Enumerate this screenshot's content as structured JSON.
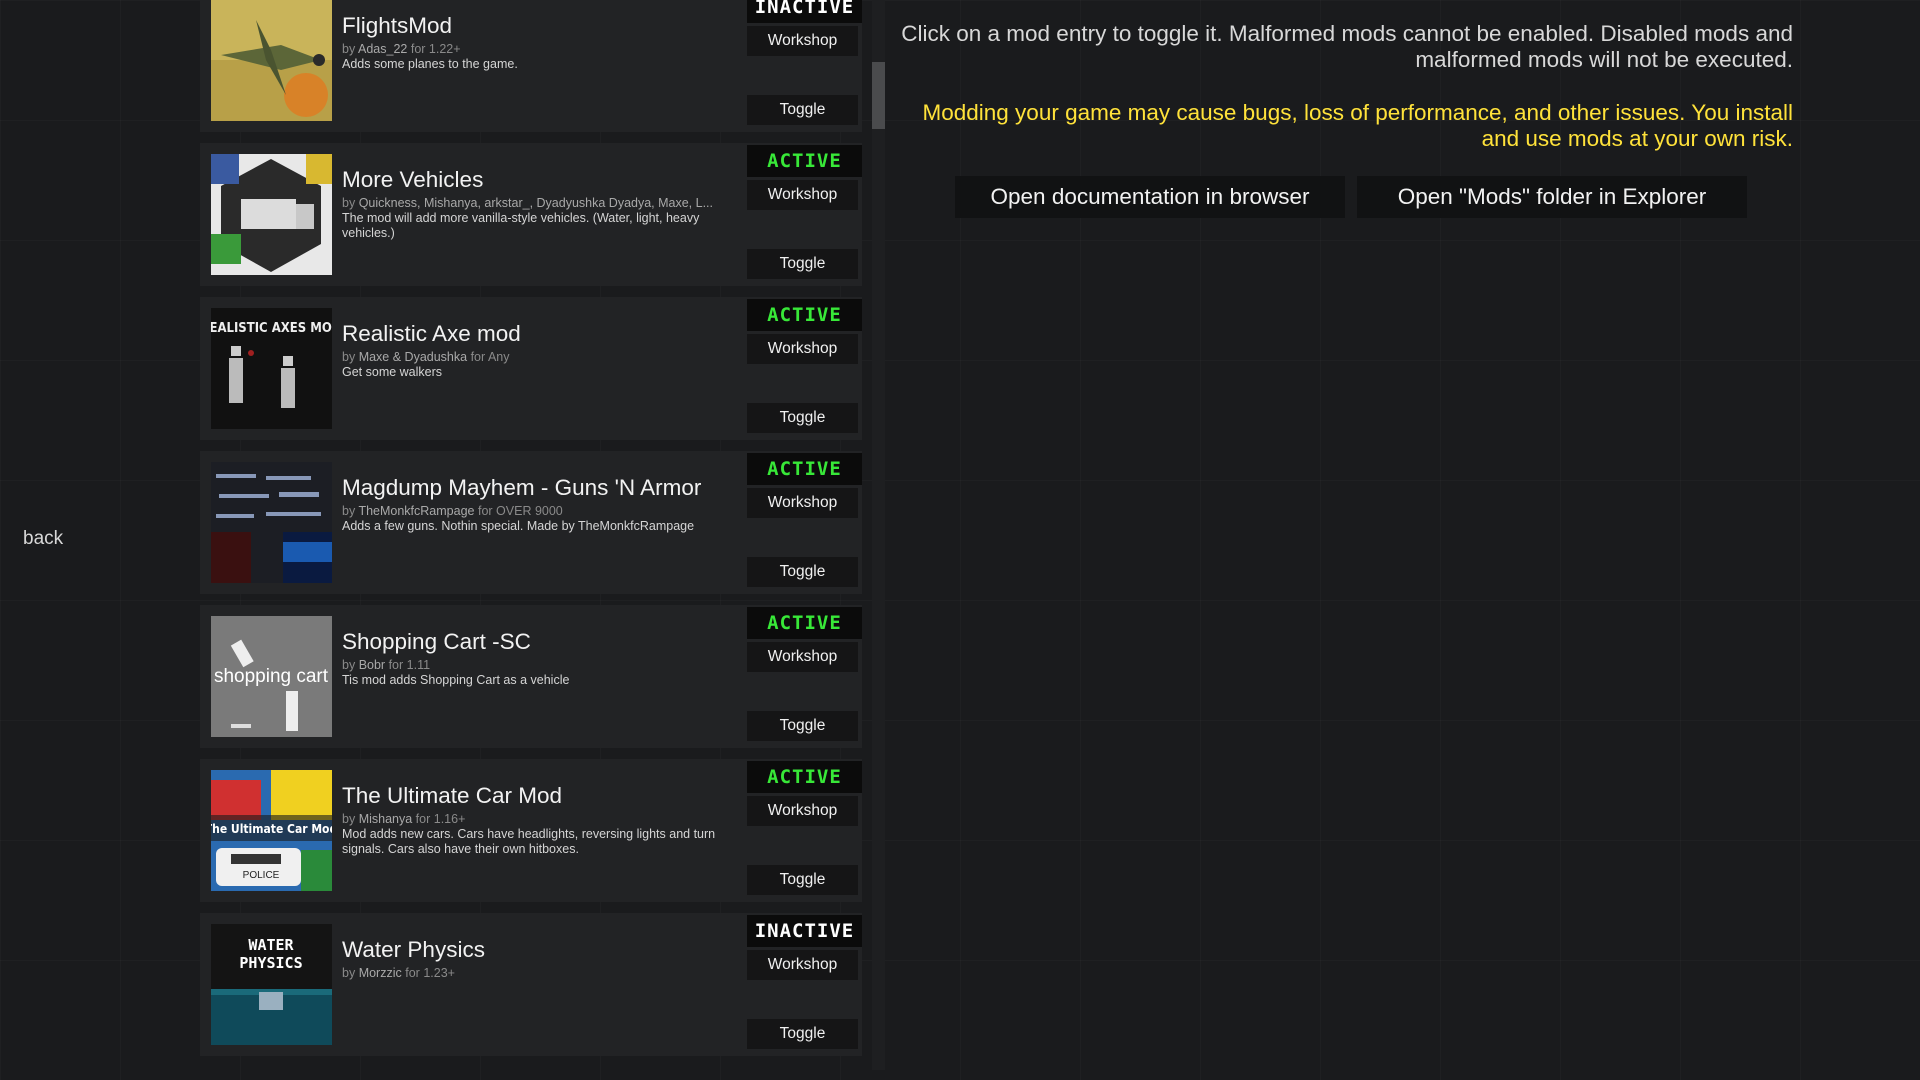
{
  "back_label": "back",
  "info": {
    "instructions": "Click on a mod entry to toggle it. Malformed mods cannot be enabled. Disabled mods and malformed mods will not be executed.",
    "warning": "Modding your game may cause bugs, loss of performance, and other issues. You install and use mods at your own risk."
  },
  "actions": {
    "open_docs": "Open documentation in browser",
    "open_folder": "Open \"Mods\" folder in Explorer"
  },
  "colors": {
    "active_status": "#38e838",
    "warning_text": "#ffe23a",
    "background": "#1a1b1d"
  },
  "mods": [
    {
      "title": "FlightsMod",
      "by_prefix": "by",
      "author": "Adas_22",
      "for_prefix": "for",
      "version": "1.22+",
      "description": "Adds some planes to the game.",
      "status": "INACTIVE",
      "workshop_label": "Workshop",
      "toggle_label": "Toggle",
      "thumb_icon": "plane-thumbnail"
    },
    {
      "title": "More Vehicles",
      "by_prefix": "by",
      "author": "Quickness, Mishanya, arkstar_, Dyadyushka Dyadya, Maxe, L...",
      "for_prefix": "",
      "version": "",
      "description": "The mod will add more vanilla-style vehicles. (Water, light, heavy vehicles.)",
      "status": "ACTIVE",
      "workshop_label": "Workshop",
      "toggle_label": "Toggle",
      "thumb_icon": "vehicles-thumbnail"
    },
    {
      "title": "Realistic Axe mod",
      "by_prefix": "by",
      "author": "Maxe & Dyadushka",
      "for_prefix": "for",
      "version": "Any",
      "description": "Get some walkers",
      "status": "ACTIVE",
      "workshop_label": "Workshop",
      "toggle_label": "Toggle",
      "thumb_icon": "axe-thumbnail",
      "thumb_text": "REALISTIC AXES MOD"
    },
    {
      "title": "Magdump Mayhem - Guns 'N Armor",
      "by_prefix": "by",
      "author": "TheMonkfcRampage",
      "for_prefix": "for",
      "version": "OVER 9000",
      "description": "Adds a few guns. Nothin special. Made by TheMonkfcRampage",
      "status": "ACTIVE",
      "workshop_label": "Workshop",
      "toggle_label": "Toggle",
      "thumb_icon": "guns-thumbnail"
    },
    {
      "title": "Shopping Cart -SC",
      "by_prefix": "by",
      "author": "Bobr",
      "for_prefix": "for",
      "version": "1.11",
      "description": "Tis mod adds Shopping Cart as a vehicle",
      "status": "ACTIVE",
      "workshop_label": "Workshop",
      "toggle_label": "Toggle",
      "thumb_icon": "cart-thumbnail",
      "thumb_text": "shopping cart"
    },
    {
      "title": "The Ultimate Car Mod",
      "by_prefix": "by",
      "author": "Mishanya",
      "for_prefix": "for",
      "version": "1.16+",
      "description": "Mod adds new cars. Cars have headlights, reversing lights and turn signals. Cars also have their own hitboxes.",
      "status": "ACTIVE",
      "workshop_label": "Workshop",
      "toggle_label": "Toggle",
      "thumb_icon": "car-thumbnail",
      "thumb_text": "The Ultimate Car Mod",
      "thumb_text2": "POLICE"
    },
    {
      "title": "Water Physics",
      "by_prefix": "by",
      "author": "Morzzic",
      "for_prefix": "for",
      "version": "1.23+",
      "description": "",
      "status": "INACTIVE",
      "workshop_label": "Workshop",
      "toggle_label": "Toggle",
      "thumb_icon": "water-thumbnail",
      "thumb_text": "WATER",
      "thumb_text2": "PHYSICS"
    }
  ]
}
